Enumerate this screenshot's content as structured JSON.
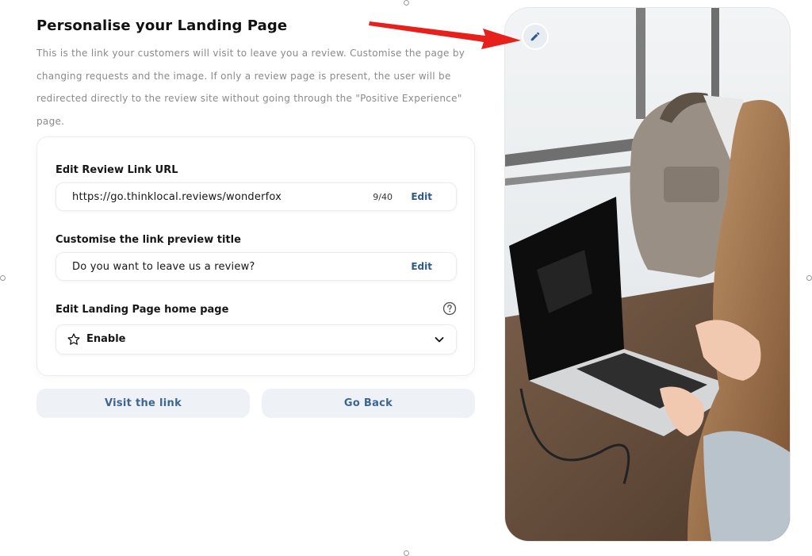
{
  "header": {
    "title": "Personalise your Landing Page",
    "description": "This is the link your customers will visit to leave you a review. Customise the page by changing requests and the image. If only a review page is present, the user will be redirected directly to the review site without going through the \"Positive Experience\" page."
  },
  "review_link": {
    "label": "Edit Review Link URL",
    "value": "https://go.thinklocal.reviews/wonderfox",
    "counter": "9/40",
    "edit_label": "Edit"
  },
  "preview_title": {
    "label": "Customise the link preview title",
    "value": "Do you want to leave us a review?",
    "edit_label": "Edit"
  },
  "home_page": {
    "label": "Edit Landing Page home page",
    "selected": "Enable"
  },
  "buttons": {
    "visit_label": "Visit the link",
    "back_label": "Go Back"
  },
  "icons": {
    "help": "question-circle-icon",
    "star": "star-icon",
    "chevron": "chevron-down-icon",
    "pencil": "pencil-icon",
    "arrow": "red-arrow"
  },
  "colors": {
    "accent": "#2f5a87",
    "button_bg": "#eef2f6",
    "arrow": "#e8201b"
  }
}
